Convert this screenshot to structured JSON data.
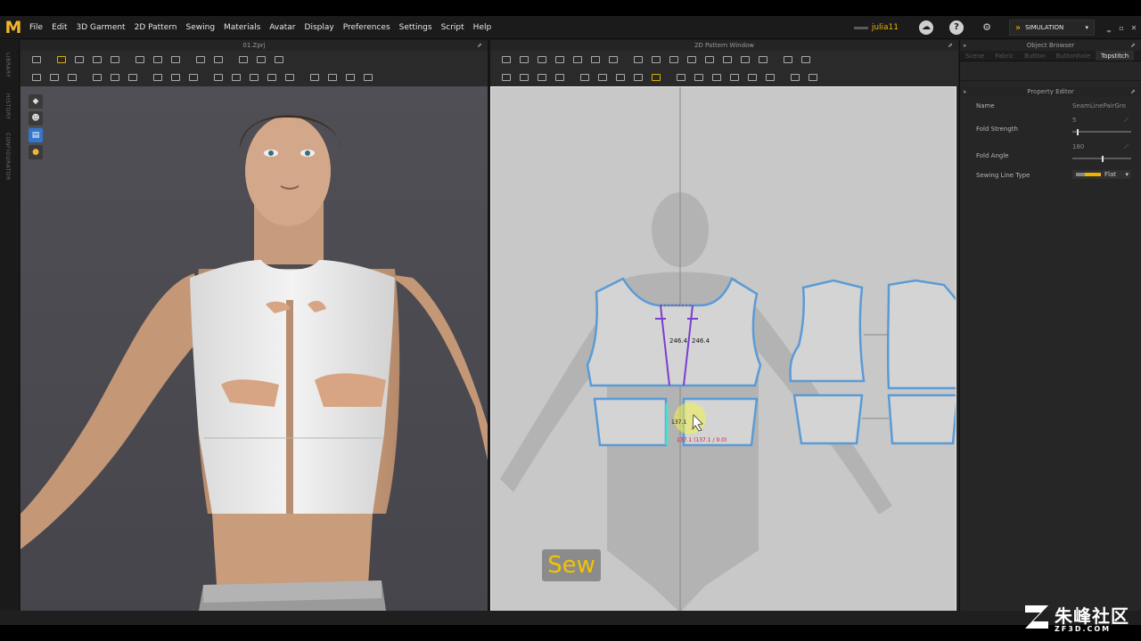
{
  "app": {
    "logo_text": "M",
    "menu": [
      "File",
      "Edit",
      "3D Garment",
      "2D Pattern",
      "Sewing",
      "Materials",
      "Avatar",
      "Display",
      "Preferences",
      "Settings",
      "Script",
      "Help"
    ],
    "user": "julia11",
    "mode": "SIMULATION"
  },
  "left_tabs": [
    "LIBRARY",
    "HISTORY",
    "CONFIGURATOR"
  ],
  "panel3d": {
    "title": "01.Zprj"
  },
  "panel2d": {
    "title": "2D Pattern Window",
    "measure_1": "246.4",
    "measure_2": "246.4",
    "measure_3": "137.1",
    "measure_red": "137.1 (137.1 / 0.0)",
    "sew_label": "Sew"
  },
  "object_browser": {
    "title": "Object Browser",
    "tabs": [
      "Scene",
      "Fabric",
      "Button",
      "Buttonhole",
      "Topstitch"
    ],
    "active_tab": "Topstitch"
  },
  "property_editor": {
    "title": "Property Editor",
    "name_label": "Name",
    "name_value": "SeamLinePairGro",
    "fold_strength_label": "Fold Strength",
    "fold_strength_value": "5",
    "fold_strength_level": 0.08,
    "fold_angle_label": "Fold Angle",
    "fold_angle_value": "180",
    "fold_angle_level": 0.5,
    "sewing_line_label": "Sewing Line Type",
    "sewing_line_value": "Flat"
  },
  "colors": {
    "accent": "#f0b400",
    "seam_blue": "#5b9bd5",
    "seam_purple": "#7a3fd0",
    "sew_text": "#f5c300"
  },
  "watermark": {
    "big": "朱峰社区",
    "small": "ZF3D.COM"
  }
}
